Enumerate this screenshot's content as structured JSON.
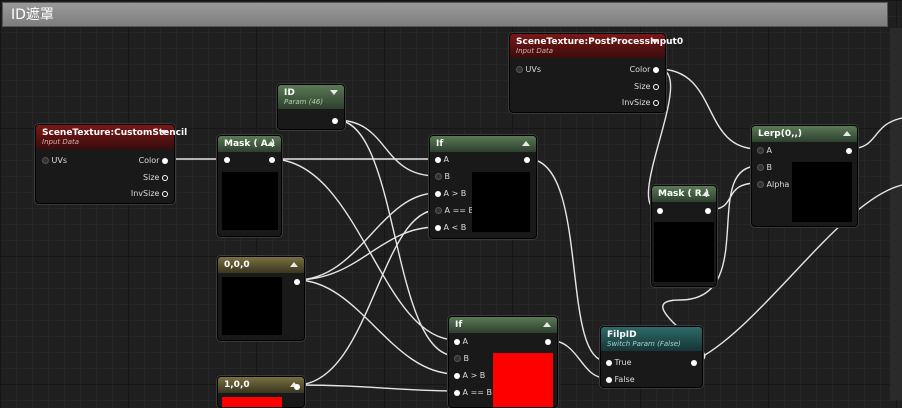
{
  "title": "ID遮罩",
  "nodes": {
    "stencil": {
      "title": "SceneTexture:CustomStencil",
      "subtitle": "Input Data",
      "in_uvs": "UVs",
      "out_color": "Color",
      "out_size": "Size",
      "out_invsize": "InvSize"
    },
    "post": {
      "title": "SceneTexture:PostProcessInput0",
      "subtitle": "Input Data",
      "in_uvs": "UVs",
      "out_color": "Color",
      "out_size": "Size",
      "out_invsize": "InvSize"
    },
    "id": {
      "title": "ID",
      "subtitle": "Param (46)"
    },
    "mask_a": {
      "title": "Mask ( A )"
    },
    "if1": {
      "title": "If",
      "pins": [
        "A",
        "B",
        "A > B",
        "A == B",
        "A < B"
      ]
    },
    "c000": {
      "title": "0,0,0"
    },
    "c100": {
      "title": "1,0,0"
    },
    "if2": {
      "title": "If",
      "pins": [
        "A",
        "B",
        "A > B",
        "A == B"
      ]
    },
    "mask_r": {
      "title": "Mask ( R )"
    },
    "lerp": {
      "title": "Lerp(0,,)",
      "pins": [
        "A",
        "B",
        "Alpha"
      ]
    },
    "filpid": {
      "title": "FilpID",
      "subtitle": "Switch Param (False)",
      "pins": [
        "True",
        "False"
      ]
    }
  },
  "colors": {
    "preview_red": "#ff0000",
    "wire": "#e6e6e6"
  }
}
